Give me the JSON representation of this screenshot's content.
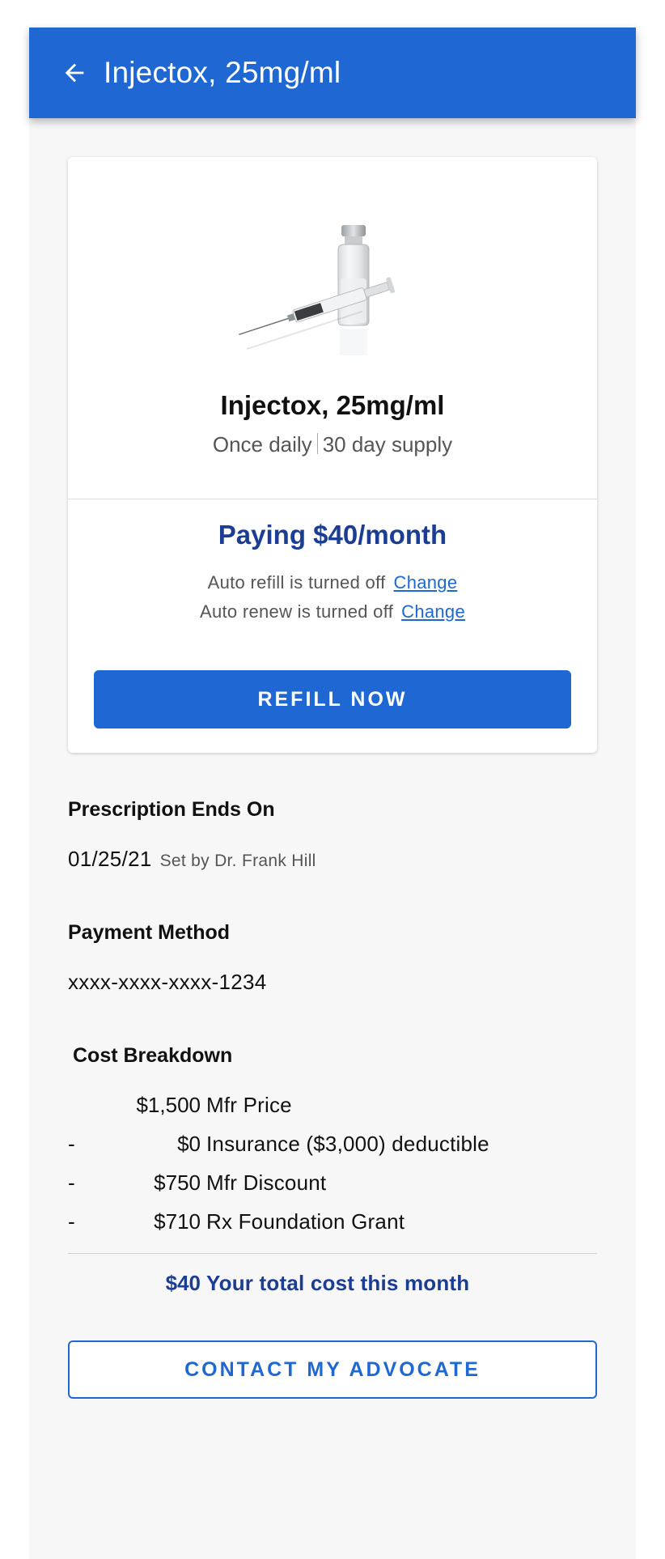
{
  "header": {
    "title": "Injectox, 25mg/ml",
    "back_icon": "arrow-left-icon"
  },
  "drug_card": {
    "image": "vial-and-syringe-image",
    "name": "Injectox, 25mg/ml",
    "frequency": "Once daily",
    "supply": "30 day supply",
    "paying": "Paying $40/month",
    "auto_refill_text": "Auto refill is turned off",
    "auto_refill_link": "Change",
    "auto_renew_text": "Auto renew is turned off",
    "auto_renew_link": "Change",
    "refill_button": "REFILL NOW"
  },
  "prescription": {
    "label": "Prescription Ends On",
    "date": "01/25/21",
    "set_by": "Set by Dr. Frank Hill"
  },
  "payment": {
    "label": "Payment Method",
    "value": "xxxx-xxxx-xxxx-1234"
  },
  "cost_breakdown": {
    "label": "Cost Breakdown",
    "rows": [
      {
        "op": "",
        "amount": "$1,500",
        "desc": "Mfr Price"
      },
      {
        "op": "-",
        "amount": "$0",
        "desc": "Insurance ($3,000) deductible"
      },
      {
        "op": "-",
        "amount": "$750",
        "desc": "Mfr Discount"
      },
      {
        "op": "-",
        "amount": "$710",
        "desc": "Rx Foundation Grant"
      }
    ],
    "total_amount": "$40",
    "total_desc": "Your total cost this month"
  },
  "contact_button": "CONTACT MY ADVOCATE",
  "colors": {
    "primary": "#1f68d4",
    "navy": "#1c3d94",
    "background": "#f7f7f7"
  }
}
